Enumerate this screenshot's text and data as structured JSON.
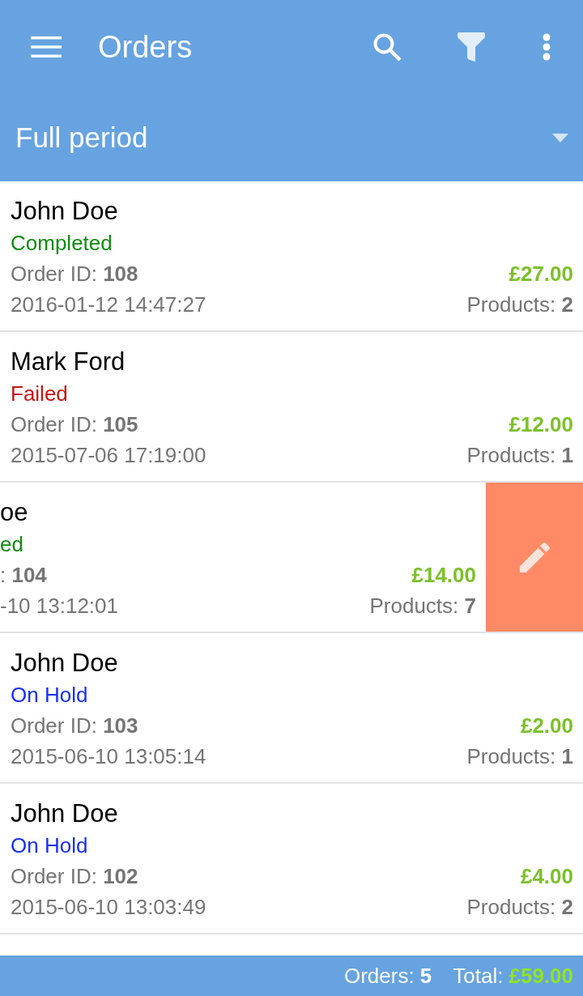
{
  "app_bar": {
    "title": "Orders"
  },
  "period": {
    "label": "Full period"
  },
  "orders": [
    {
      "kind": "normal",
      "customer": "John Doe",
      "status": {
        "label": "Completed",
        "color": "#0f8c0f"
      },
      "order_id": "Order ID: **108**",
      "date": "2016-01-12 14:47:27",
      "total": "£27.00",
      "products": "Products: **2**"
    },
    {
      "kind": "normal",
      "customer": "Mark Ford",
      "status": {
        "label": "Failed",
        "color": "#c4160f"
      },
      "order_id": "Order ID: **105**",
      "date": "2015-07-06 17:19:00",
      "total": "£12.00",
      "products": "Products: **1**"
    },
    {
      "kind": "swiped",
      "customer": "oe",
      "status": {
        "label": "ed",
        "color": "#0f8c0f"
      },
      "order_id": ": **104**",
      "date": "-10 13:12:01",
      "total": "£14.00",
      "products": "Products: **7**"
    },
    {
      "kind": "normal",
      "customer": "John Doe",
      "status": {
        "label": "On Hold",
        "color": "#1530f5"
      },
      "order_id": "Order ID: **103**",
      "date": "2015-06-10 13:05:14",
      "total": "£2.00",
      "products": "Products: **1**"
    },
    {
      "kind": "normal",
      "customer": "John Doe",
      "status": {
        "label": "On Hold",
        "color": "#1530f5"
      },
      "order_id": "Order ID: **102**",
      "date": "2015-06-10 13:03:49",
      "total": "£4.00",
      "products": "Products: **2**"
    }
  ],
  "footer": {
    "orders": "Orders: **5**",
    "total_label": "Total:",
    "total_value": "£59.00"
  }
}
